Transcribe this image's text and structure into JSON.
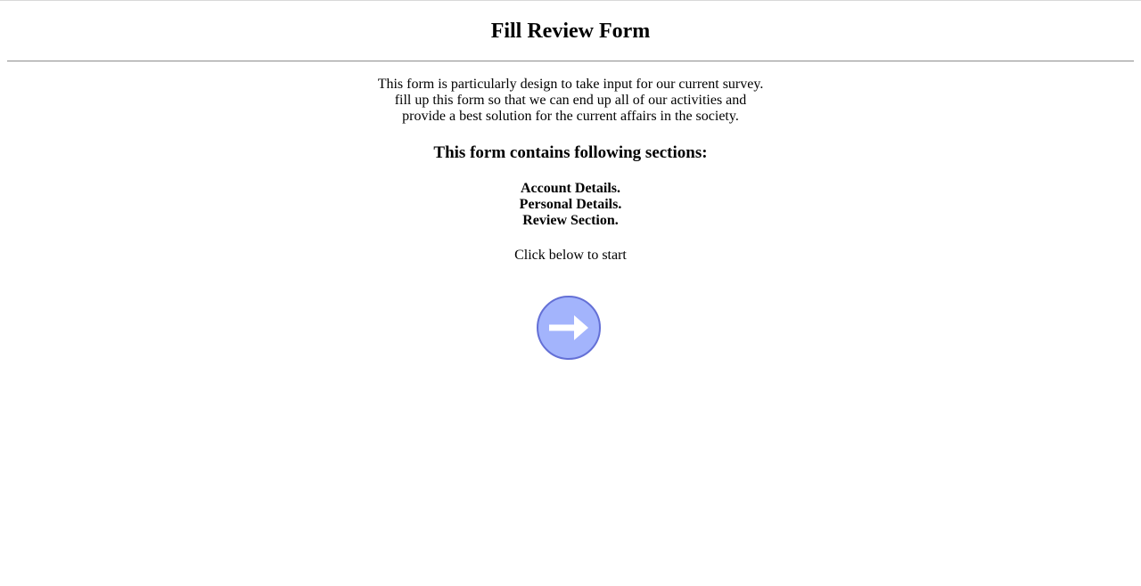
{
  "page": {
    "title": "Fill Review Form"
  },
  "intro": {
    "lines": [
      "This form is particularly design to take input for our current survey.",
      "fill up this form so that we can end up all of our activities and",
      "provide a best solution for the current affairs in the society."
    ]
  },
  "sections_heading": "This form contains following sections:",
  "sections": [
    "Account Details.",
    "Personal Details.",
    "Review Section."
  ],
  "cta": {
    "text": "Click below to start",
    "button_icon": "arrow-right-icon"
  },
  "colors": {
    "button_fill": "#a3b4fc",
    "button_border": "#6470d6",
    "arrow": "#ffffff"
  }
}
